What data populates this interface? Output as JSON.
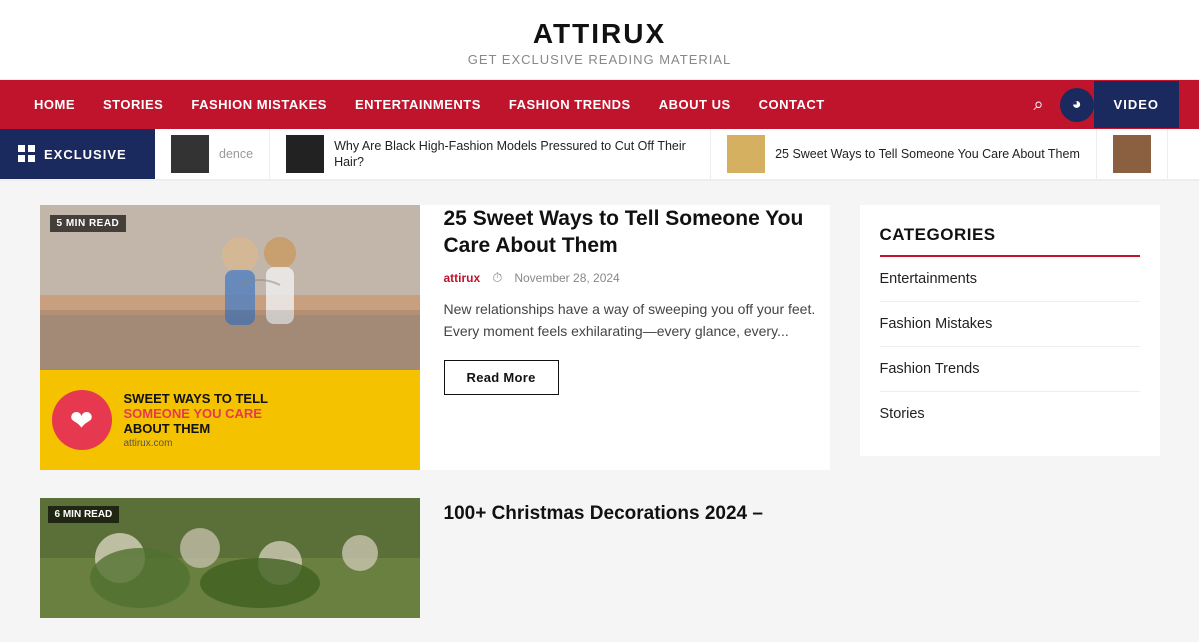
{
  "header": {
    "title": "ATTIRUX",
    "tagline": "GET EXCLUSIVE READING MATERIAL"
  },
  "nav": {
    "items": [
      {
        "label": "HOME",
        "id": "home"
      },
      {
        "label": "STORIES",
        "id": "stories"
      },
      {
        "label": "FASHION MISTAKES",
        "id": "fashion-mistakes"
      },
      {
        "label": "ENTERTAINMENTS",
        "id": "entertainments"
      },
      {
        "label": "FASHION TRENDS",
        "id": "fashion-trends"
      },
      {
        "label": "ABOUT US",
        "id": "about-us"
      },
      {
        "label": "CONTACT",
        "id": "contact"
      }
    ],
    "video_label": "VIDEO"
  },
  "ticker": {
    "label": "EXCLUSIVE",
    "items": [
      {
        "text": "dence",
        "has_thumb": true
      },
      {
        "text": "Why Are Black High-Fashion Models Pressured to Cut Off Their Hair?",
        "has_thumb": true
      },
      {
        "text": "25 Sweet Ways to Tell Someone You Care About Them",
        "has_thumb": true
      }
    ]
  },
  "articles": [
    {
      "read_time": "5 MIN READ",
      "title": "25 Sweet Ways to Tell Someone You Care About Them",
      "author": "attirux",
      "date": "November 28, 2024",
      "excerpt": "New relationships have a way of sweeping you off your feet. Every moment feels exhilarating—every glance, every...",
      "read_more": "Read More",
      "secondary_lines": [
        "SWEET WAYS TO TELL",
        "SOMEONE YOU CARE",
        "ABOUT THEM"
      ],
      "secondary_site": "attirux.com"
    },
    {
      "read_time": "6 MIN READ",
      "title": "100+ Christmas Decorations 2024 –"
    }
  ],
  "sidebar": {
    "categories_title": "CATEGORIES",
    "categories": [
      {
        "label": "Entertainments"
      },
      {
        "label": "Fashion Mistakes"
      },
      {
        "label": "Fashion Trends"
      },
      {
        "label": "Stories"
      }
    ]
  }
}
